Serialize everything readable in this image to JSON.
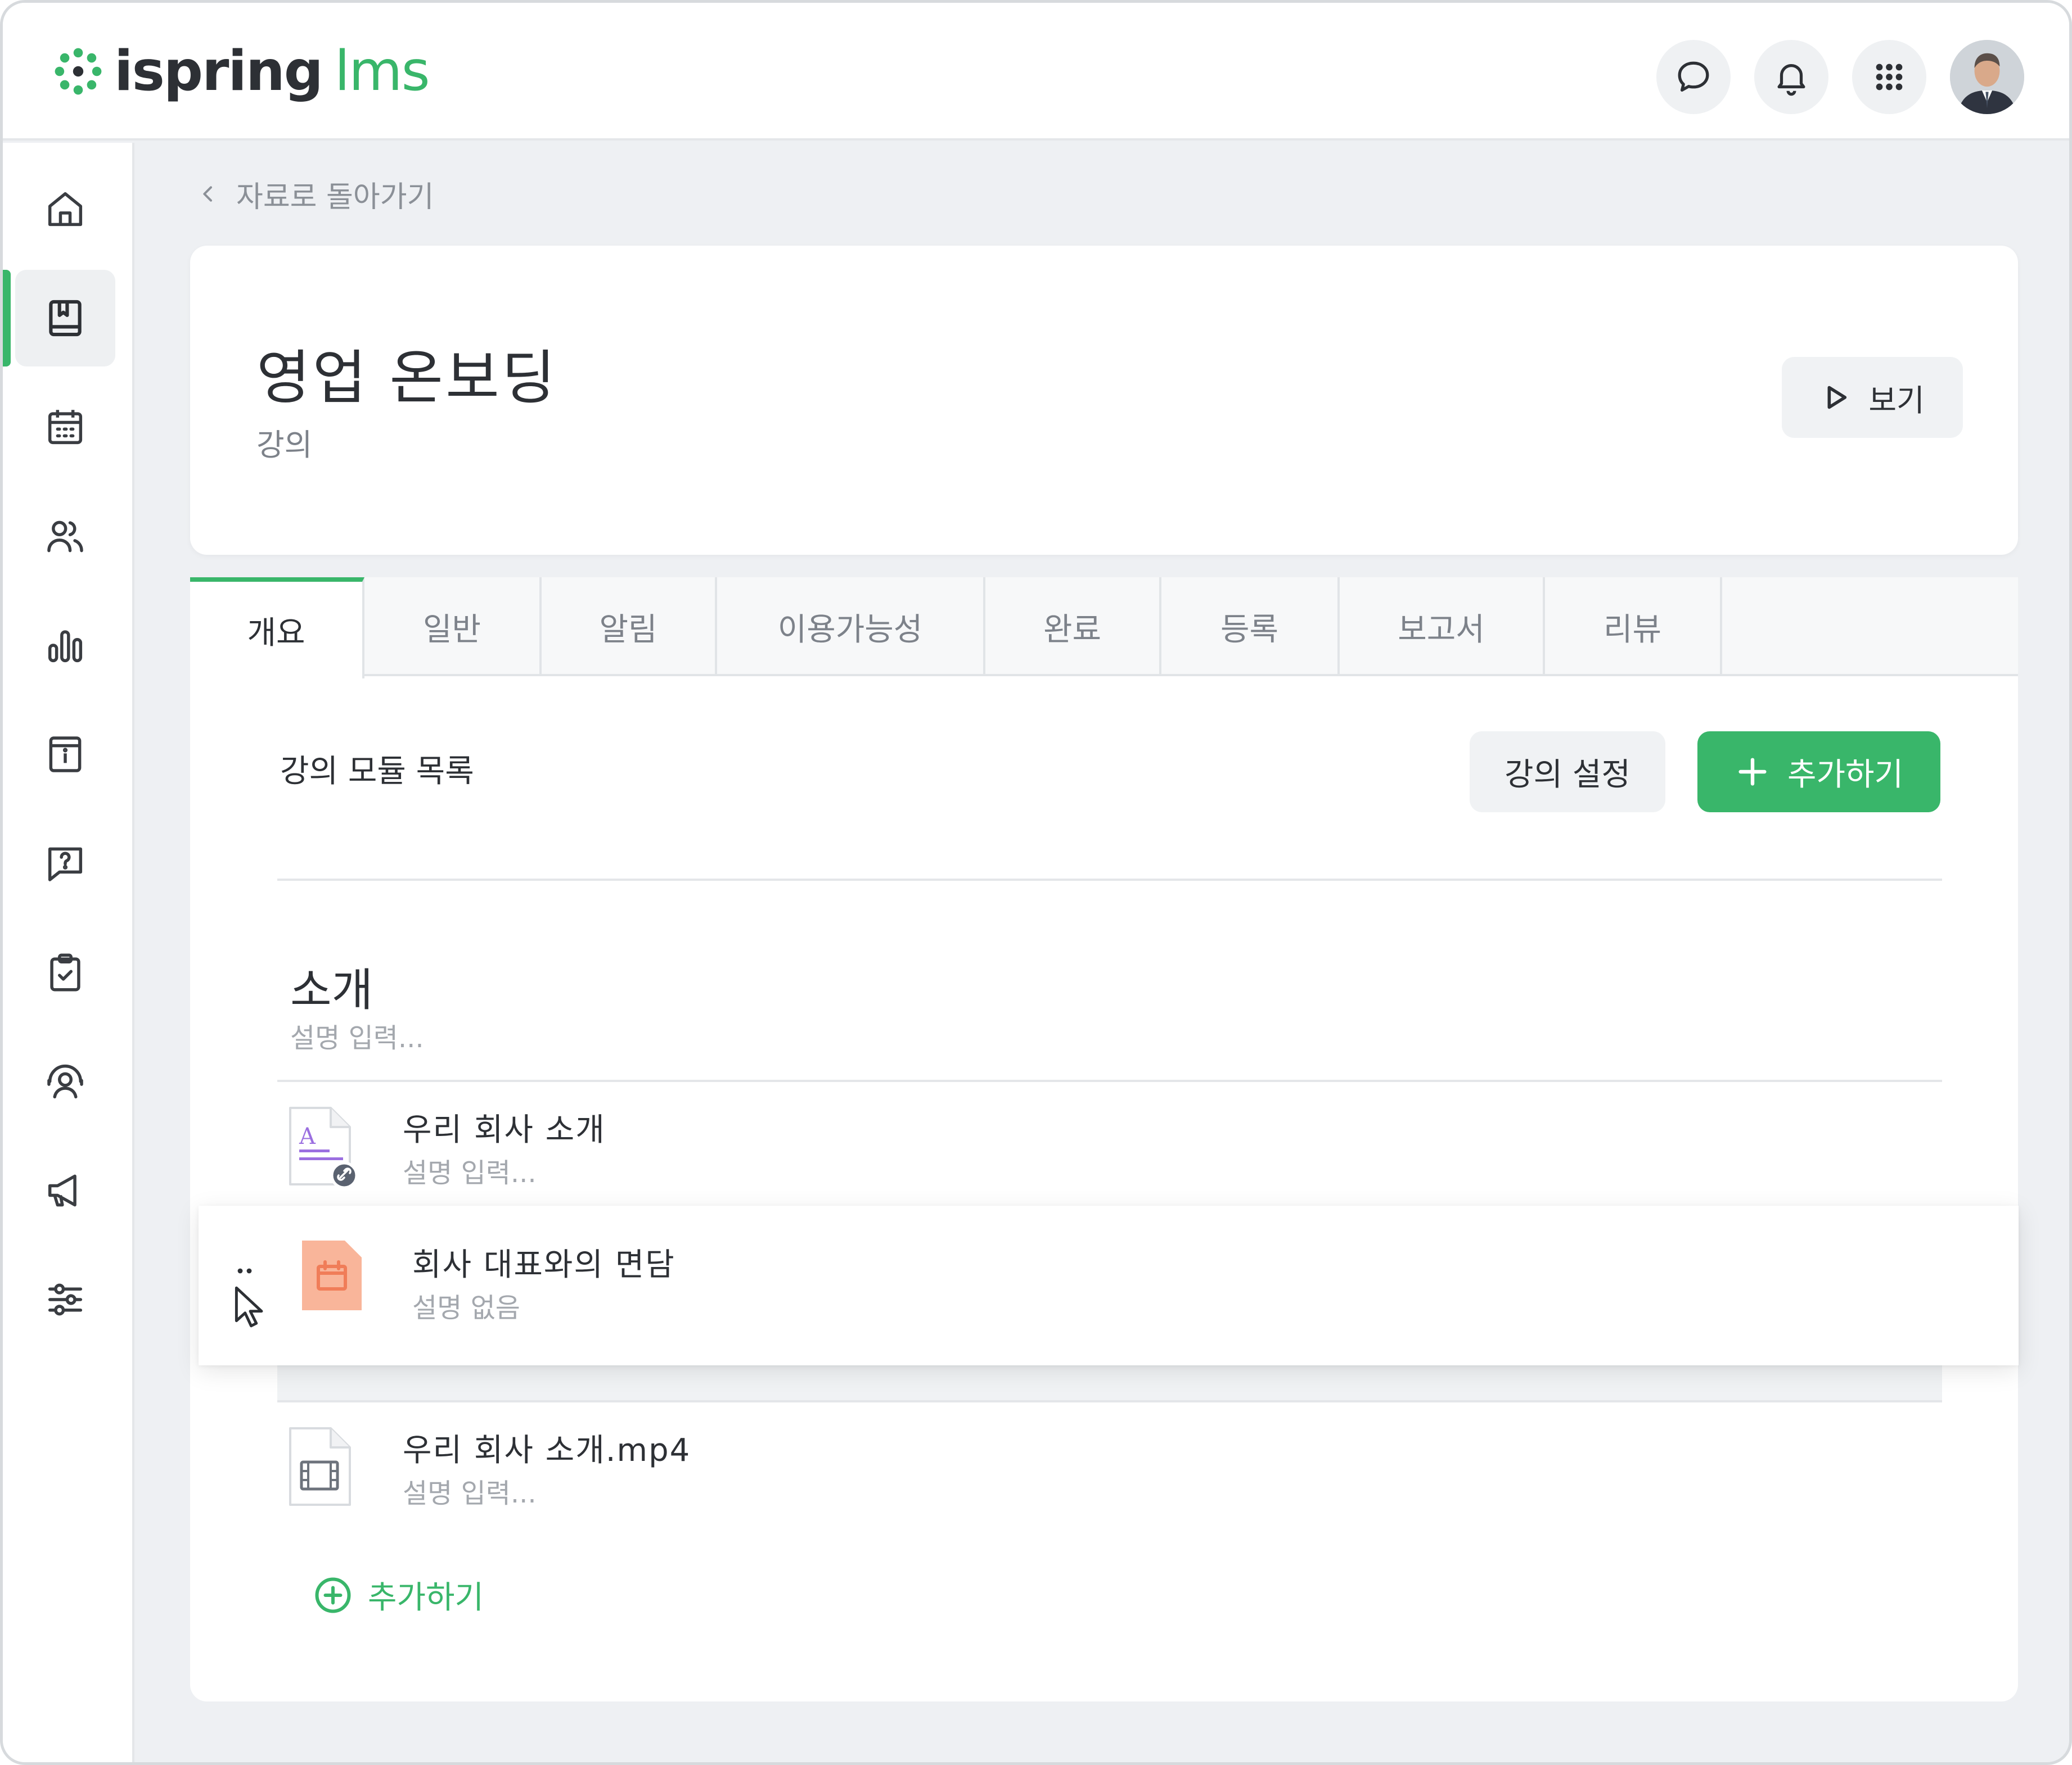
{
  "app": {
    "logo_text": "ispring",
    "logo_suffix": "lms"
  },
  "header": {
    "icons": [
      "chat-icon",
      "bell-icon",
      "apps-grid-icon"
    ],
    "avatar": "user-avatar"
  },
  "sidebar": {
    "items": [
      {
        "name": "home-icon",
        "active": false
      },
      {
        "name": "book-icon",
        "active": true
      },
      {
        "name": "calendar-icon",
        "active": false
      },
      {
        "name": "users-icon",
        "active": false
      },
      {
        "name": "reports-icon",
        "active": false
      },
      {
        "name": "info-icon",
        "active": false
      },
      {
        "name": "question-icon",
        "active": false
      },
      {
        "name": "clipboard-check-icon",
        "active": false
      },
      {
        "name": "support-icon",
        "active": false
      },
      {
        "name": "megaphone-icon",
        "active": false
      },
      {
        "name": "settings-sliders-icon",
        "active": false
      }
    ],
    "accent": "#39b66a"
  },
  "breadcrumb": {
    "back_label": "자료로 돌아가기"
  },
  "course": {
    "title": "영업 온보딩",
    "type": "강의",
    "view_label": "보기"
  },
  "tabs": [
    {
      "label": "개요",
      "active": true
    },
    {
      "label": "일반",
      "active": false
    },
    {
      "label": "알림",
      "active": false
    },
    {
      "label": "이용가능성",
      "active": false
    },
    {
      "label": "완료",
      "active": false
    },
    {
      "label": "등록",
      "active": false
    },
    {
      "label": "보고서",
      "active": false
    },
    {
      "label": "리뷰",
      "active": false
    }
  ],
  "modules": {
    "list_title": "강의 모듈 목록",
    "settings_label": "강의 설정",
    "add_label": "추가하기",
    "section": {
      "title": "소개",
      "description": "설명 입력..."
    },
    "items": [
      {
        "title": "우리 회사 소개",
        "description": "설명 입력...",
        "icon": "document-link-icon"
      },
      {
        "title": "회사 대표와의 면담",
        "description": "설명 없음",
        "icon": "meeting-calendar-icon",
        "dragging": true
      },
      {
        "title": "우리 회사 소개.mp4",
        "description": "설명 입력...",
        "icon": "video-file-icon"
      }
    ],
    "add_link_label": "추가하기"
  },
  "colors": {
    "brand_green": "#39b66a",
    "meeting_orange": "#f9b59a",
    "doc_purple": "#9b6fe0"
  }
}
